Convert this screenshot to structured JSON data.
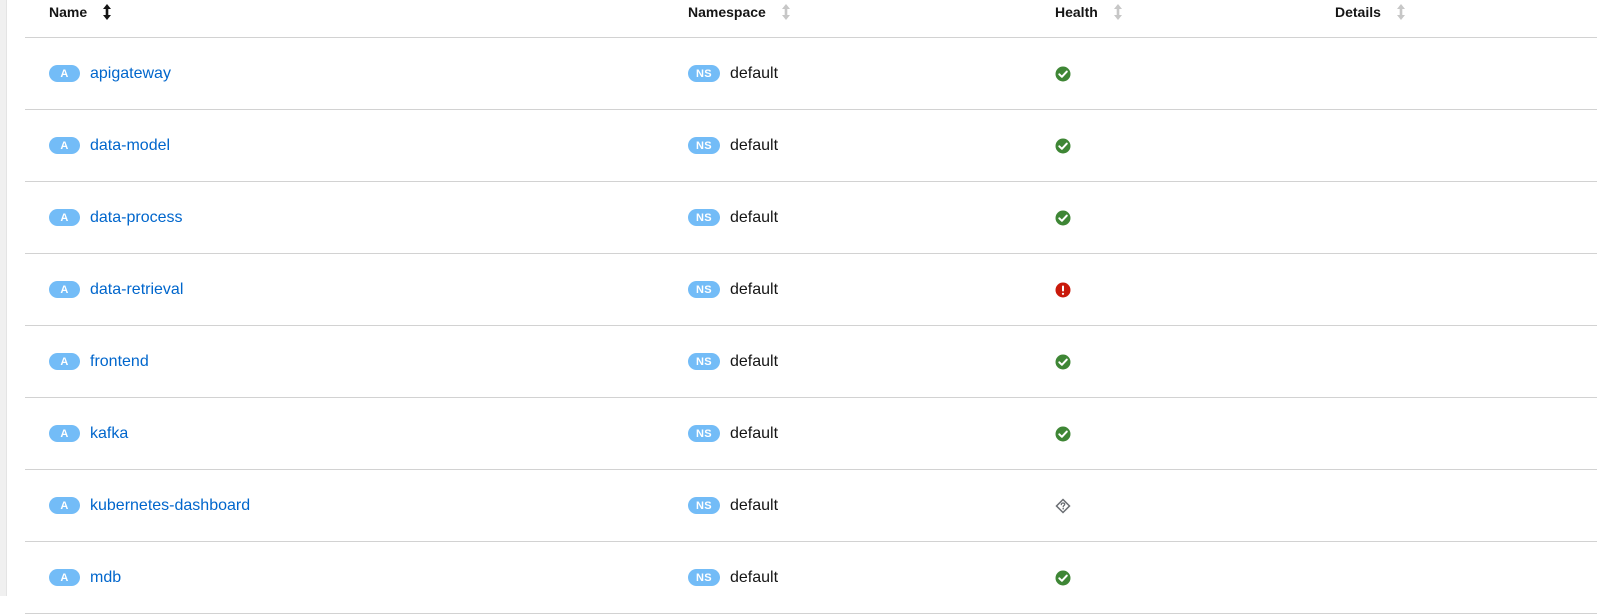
{
  "table": {
    "columns": [
      {
        "key": "name",
        "label": "Name",
        "sort_state": "active"
      },
      {
        "key": "namespace",
        "label": "Namespace",
        "sort_state": "inactive"
      },
      {
        "key": "health",
        "label": "Health",
        "sort_state": "inactive"
      },
      {
        "key": "details",
        "label": "Details",
        "sort_state": "inactive"
      }
    ],
    "rows": [
      {
        "type_badge": "A",
        "name": "apigateway",
        "ns_badge": "NS",
        "namespace": "default",
        "health": "healthy",
        "details": ""
      },
      {
        "type_badge": "A",
        "name": "data-model",
        "ns_badge": "NS",
        "namespace": "default",
        "health": "healthy",
        "details": ""
      },
      {
        "type_badge": "A",
        "name": "data-process",
        "ns_badge": "NS",
        "namespace": "default",
        "health": "healthy",
        "details": ""
      },
      {
        "type_badge": "A",
        "name": "data-retrieval",
        "ns_badge": "NS",
        "namespace": "default",
        "health": "failure",
        "details": ""
      },
      {
        "type_badge": "A",
        "name": "frontend",
        "ns_badge": "NS",
        "namespace": "default",
        "health": "healthy",
        "details": ""
      },
      {
        "type_badge": "A",
        "name": "kafka",
        "ns_badge": "NS",
        "namespace": "default",
        "health": "healthy",
        "details": ""
      },
      {
        "type_badge": "A",
        "name": "kubernetes-dashboard",
        "ns_badge": "NS",
        "namespace": "default",
        "health": "unknown",
        "details": ""
      },
      {
        "type_badge": "A",
        "name": "mdb",
        "ns_badge": "NS",
        "namespace": "default",
        "health": "healthy",
        "details": ""
      }
    ]
  },
  "icons": {
    "healthy": "check-circle-icon",
    "failure": "exclamation-circle-icon",
    "unknown": "question-diamond-icon",
    "sort_active": "sort-vertical-arrows-icon",
    "sort_inactive": "sort-vertical-arrows-icon"
  },
  "colors": {
    "link": "#0066cc",
    "badge": "#73bcf7",
    "healthy": "#3e8635",
    "failure": "#c9190b",
    "unknown": "#6a6e73",
    "sort_inactive": "#c7c7c7",
    "sort_active": "#151515",
    "divider": "#d2d2d2"
  }
}
